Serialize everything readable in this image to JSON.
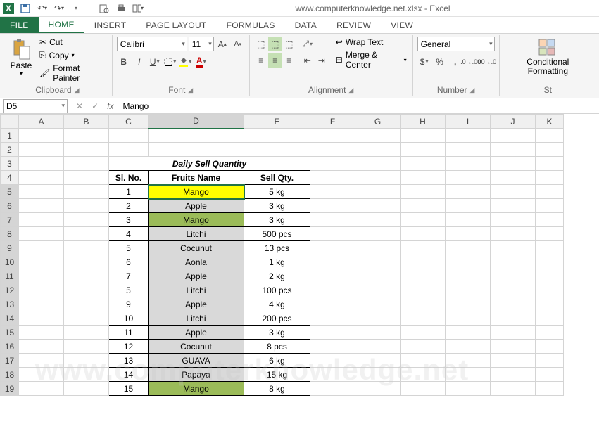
{
  "title": "www.computerknowledge.net.xlsx - Excel",
  "tabs": {
    "file": "FILE",
    "home": "HOME",
    "insert": "INSERT",
    "page_layout": "PAGE LAYOUT",
    "formulas": "FORMULAS",
    "data": "DATA",
    "review": "REVIEW",
    "view": "VIEW"
  },
  "clipboard": {
    "paste": "Paste",
    "cut": "Cut",
    "copy": "Copy",
    "fp": "Format Painter",
    "label": "Clipboard"
  },
  "font": {
    "name": "Calibri",
    "size": "11",
    "label": "Font"
  },
  "alignment": {
    "wrap": "Wrap Text",
    "merge": "Merge & Center",
    "label": "Alignment"
  },
  "number": {
    "fmt": "General",
    "label": "Number"
  },
  "styles": {
    "cond": "Conditional Formatting",
    "label": "St"
  },
  "namebox": "D5",
  "formula": "Mango",
  "cols": [
    "A",
    "B",
    "C",
    "D",
    "E",
    "F",
    "G",
    "H",
    "I",
    "J",
    "K"
  ],
  "rows_count": 19,
  "watermark": "www.computerknowledge.net",
  "table": {
    "title": "Daily Sell Quantity",
    "headers": {
      "sl": "Sl. No.",
      "fruits": "Fruits Name",
      "qty": "Sell Qty."
    },
    "rows": [
      {
        "sl": "1",
        "fruit": "Mango",
        "qty": "5 kg",
        "hl": "yellow"
      },
      {
        "sl": "2",
        "fruit": "Apple",
        "qty": "3 kg",
        "hl": ""
      },
      {
        "sl": "3",
        "fruit": "Mango",
        "qty": "3 kg",
        "hl": "olive"
      },
      {
        "sl": "4",
        "fruit": "Litchi",
        "qty": "500 pcs",
        "hl": ""
      },
      {
        "sl": "5",
        "fruit": "Cocunut",
        "qty": "13 pcs",
        "hl": ""
      },
      {
        "sl": "6",
        "fruit": "Aonla",
        "qty": "1 kg",
        "hl": ""
      },
      {
        "sl": "7",
        "fruit": "Apple",
        "qty": "2 kg",
        "hl": ""
      },
      {
        "sl": "5",
        "fruit": "Litchi",
        "qty": "100 pcs",
        "hl": ""
      },
      {
        "sl": "9",
        "fruit": "Apple",
        "qty": "4 kg",
        "hl": ""
      },
      {
        "sl": "10",
        "fruit": "Litchi",
        "qty": "200 pcs",
        "hl": ""
      },
      {
        "sl": "11",
        "fruit": "Apple",
        "qty": "3 kg",
        "hl": ""
      },
      {
        "sl": "12",
        "fruit": "Cocunut",
        "qty": "8 pcs",
        "hl": ""
      },
      {
        "sl": "13",
        "fruit": "GUAVA",
        "qty": "6 kg",
        "hl": ""
      },
      {
        "sl": "14",
        "fruit": "Papaya",
        "qty": "15 kg",
        "hl": ""
      },
      {
        "sl": "15",
        "fruit": "Mango",
        "qty": "8 kg",
        "hl": "olive"
      }
    ]
  },
  "col_widths": {
    "A": 64,
    "B": 64,
    "C": 56,
    "D": 136,
    "E": 94,
    "F": 64,
    "G": 64,
    "H": 64,
    "I": 64,
    "J": 64,
    "K": 40
  },
  "selected_cell": "D5",
  "selected_col": "D",
  "selected_rows": [
    5,
    6,
    7,
    8,
    9,
    10,
    11,
    12,
    13,
    14,
    15,
    16,
    17,
    18,
    19
  ]
}
